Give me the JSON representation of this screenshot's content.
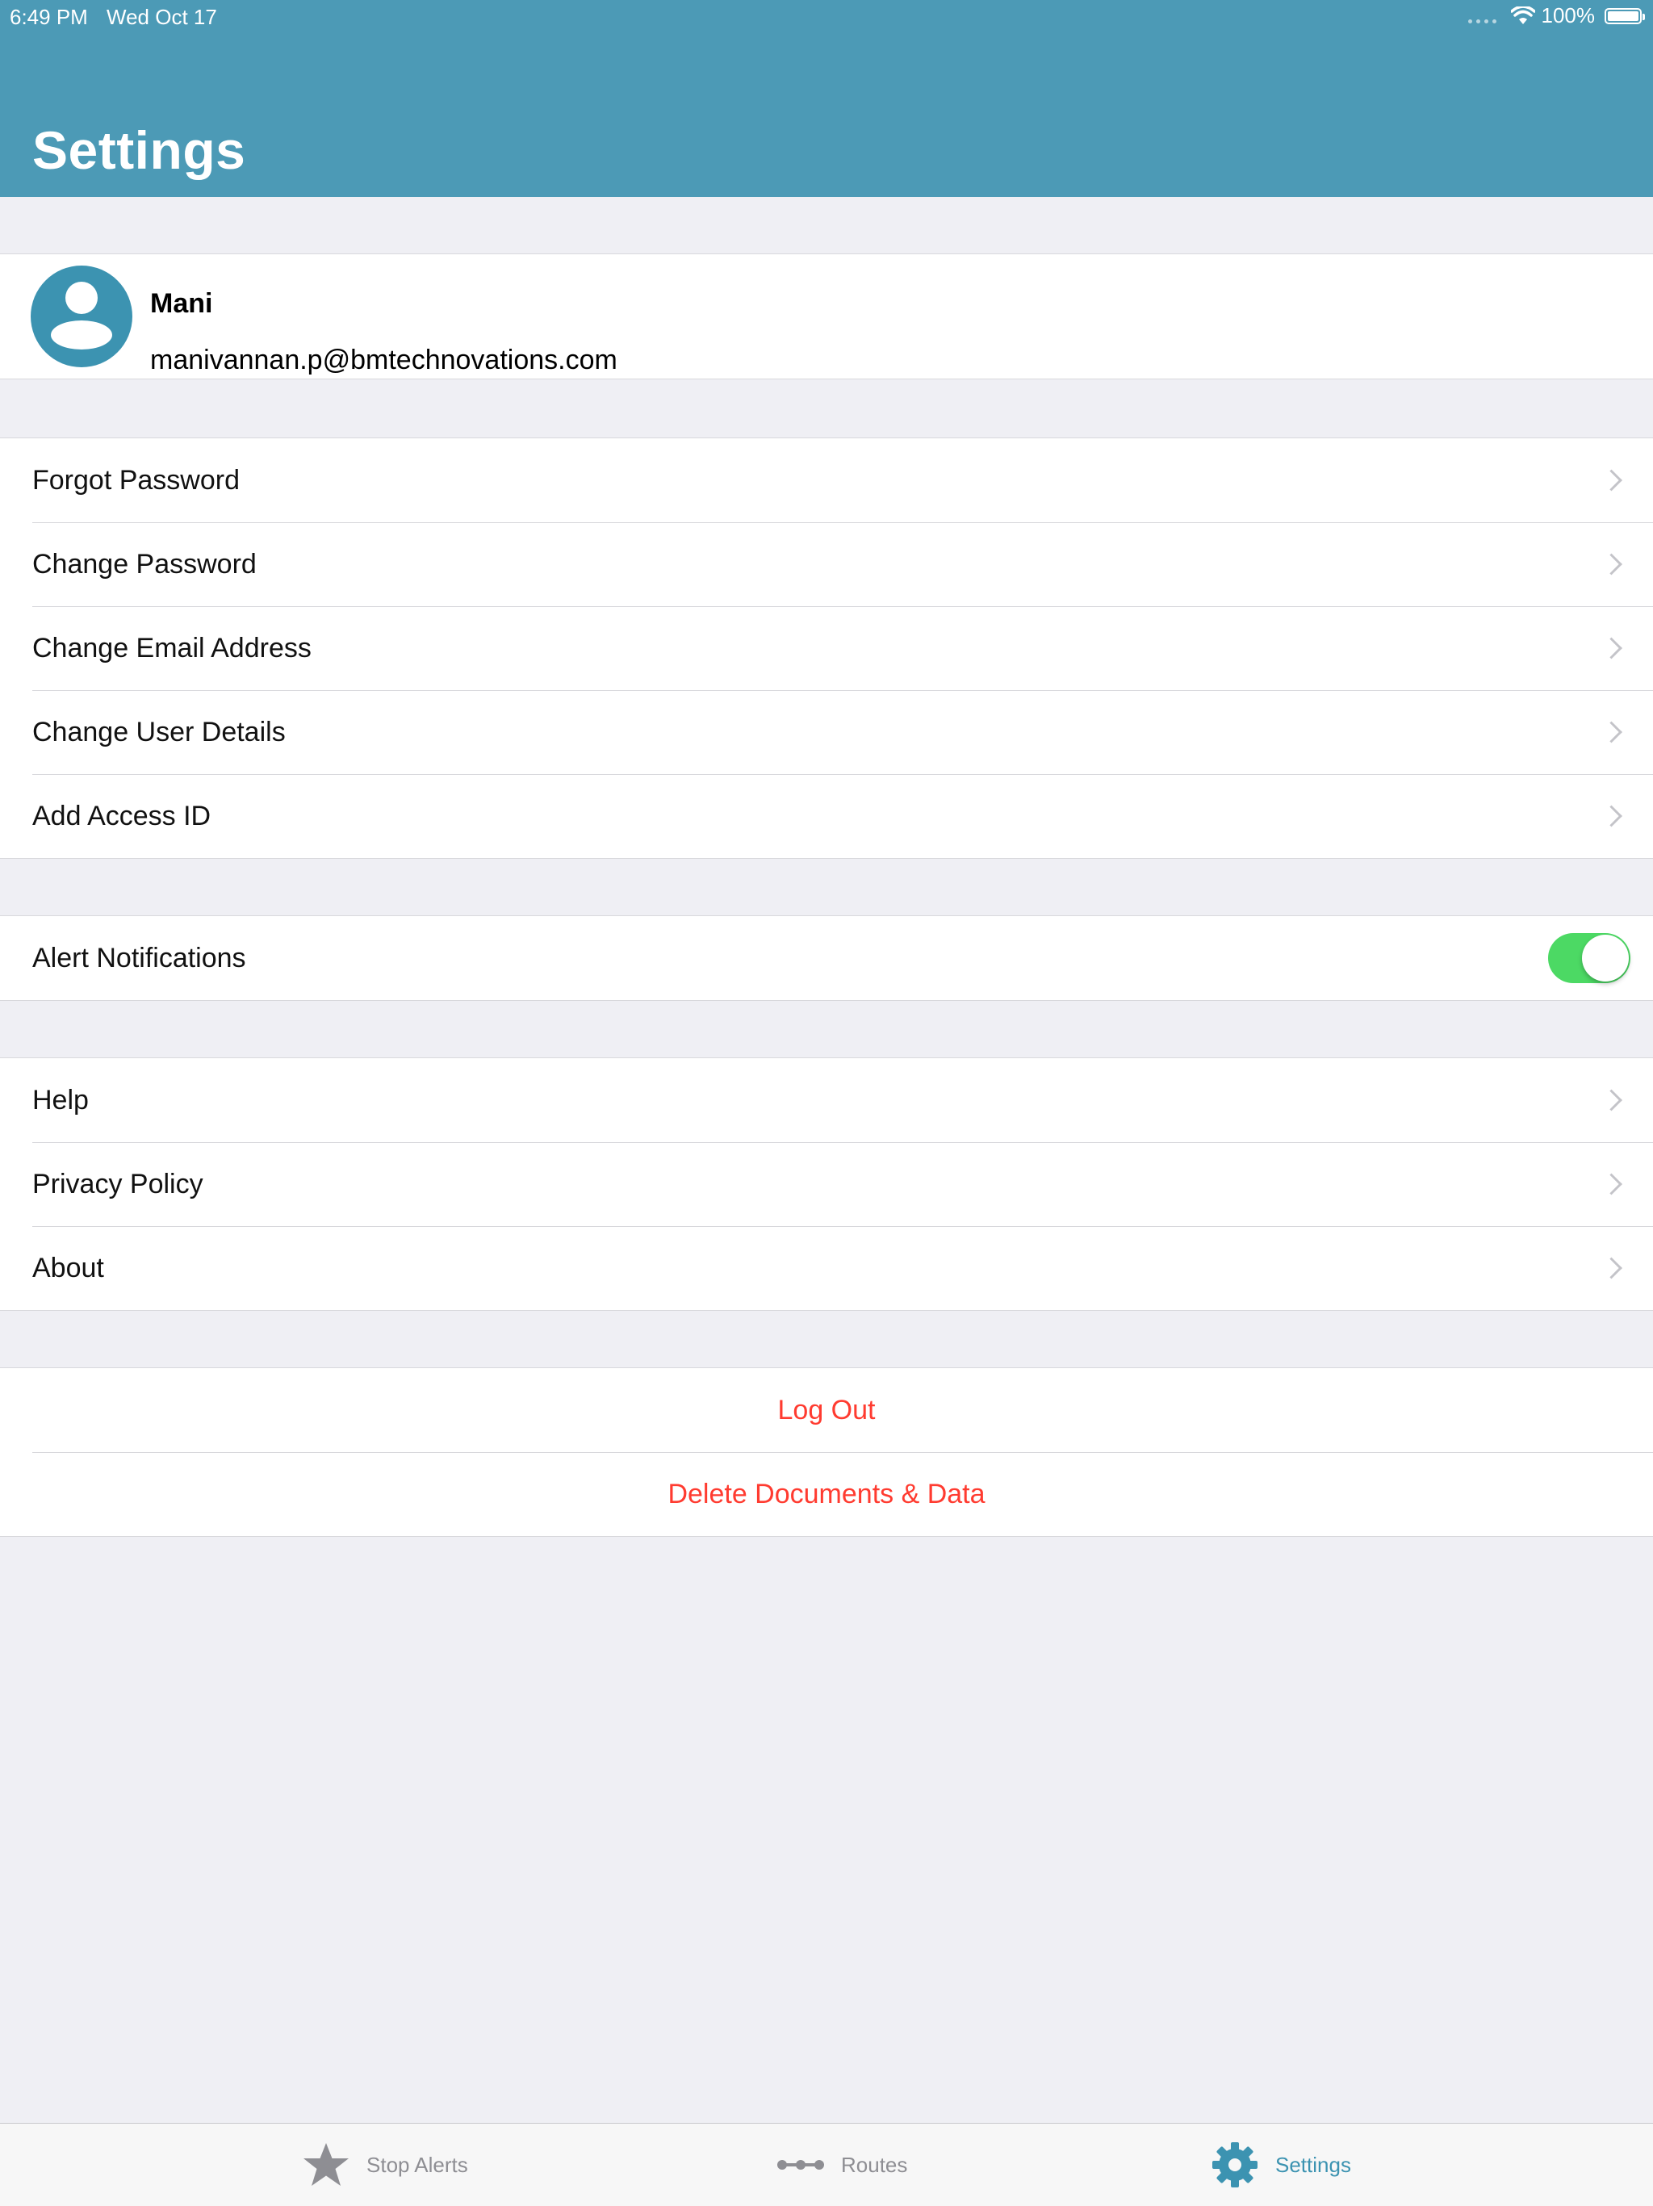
{
  "status_bar": {
    "time": "6:49 PM",
    "date": "Wed Oct 17",
    "battery": "100%"
  },
  "header": {
    "title": "Settings"
  },
  "profile": {
    "name": "Mani",
    "email": "manivannan.p@bmtechnovations.com"
  },
  "account_items": [
    {
      "label": "Forgot Password"
    },
    {
      "label": "Change Password"
    },
    {
      "label": "Change Email Address"
    },
    {
      "label": "Change User Details"
    },
    {
      "label": "Add Access ID"
    }
  ],
  "notifications": {
    "label": "Alert Notifications",
    "enabled": true
  },
  "info_items": [
    {
      "label": "Help"
    },
    {
      "label": "Privacy Policy"
    },
    {
      "label": "About"
    }
  ],
  "actions": {
    "logout": "Log Out",
    "delete": "Delete Documents & Data"
  },
  "tabbar": {
    "tabs": [
      {
        "label": "Stop Alerts",
        "icon": "star-icon"
      },
      {
        "label": "Routes",
        "icon": "route-dots-icon"
      },
      {
        "label": "Settings",
        "icon": "gear-icon",
        "selected": true
      }
    ]
  },
  "colors": {
    "header": "#4c9ab6",
    "accent": "#3c93b1",
    "toggle_on": "#4cd964",
    "destructive": "#ff3b30"
  }
}
